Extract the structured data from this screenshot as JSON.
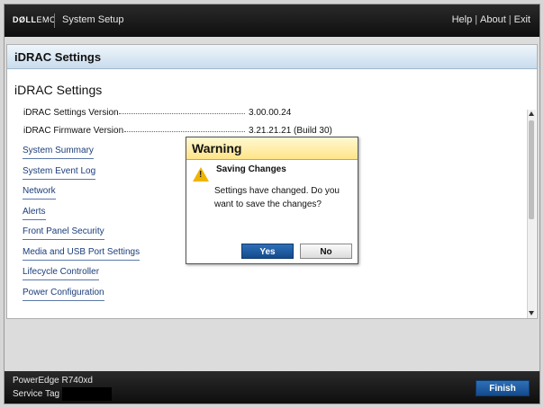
{
  "header": {
    "brand_dell": "DØLL",
    "brand_emc": "EMC",
    "app_title": "System Setup",
    "links": [
      "Help",
      "About",
      "Exit"
    ],
    "separator": "|"
  },
  "panel": {
    "header_title": "iDRAC Settings",
    "page_title": "iDRAC Settings",
    "info": [
      {
        "label": "iDRAC Settings Version",
        "value": "3.00.00.24"
      },
      {
        "label": "iDRAC Firmware Version",
        "value": "3.21.21.21 (Build 30)"
      }
    ],
    "nav": [
      "System Summary",
      "System Event Log",
      "Network",
      "Alerts",
      "Front Panel Security",
      "Media and USB Port Settings",
      "Lifecycle Controller",
      "Power Configuration"
    ]
  },
  "dialog": {
    "title": "Warning",
    "icon": "warning-icon",
    "heading": "Saving Changes",
    "message": "Settings have changed. Do you want to save the changes?",
    "yes_label": "Yes",
    "no_label": "No"
  },
  "footer": {
    "model": "PowerEdge R740xd",
    "service_tag_label": "Service Tag",
    "finish_label": "Finish"
  },
  "colors": {
    "topbar": "#121212",
    "panel_header": "#c9dced",
    "dialog_header": "#ffe488",
    "primary_button": "#1f5ca3",
    "link": "#1b3d7a"
  }
}
